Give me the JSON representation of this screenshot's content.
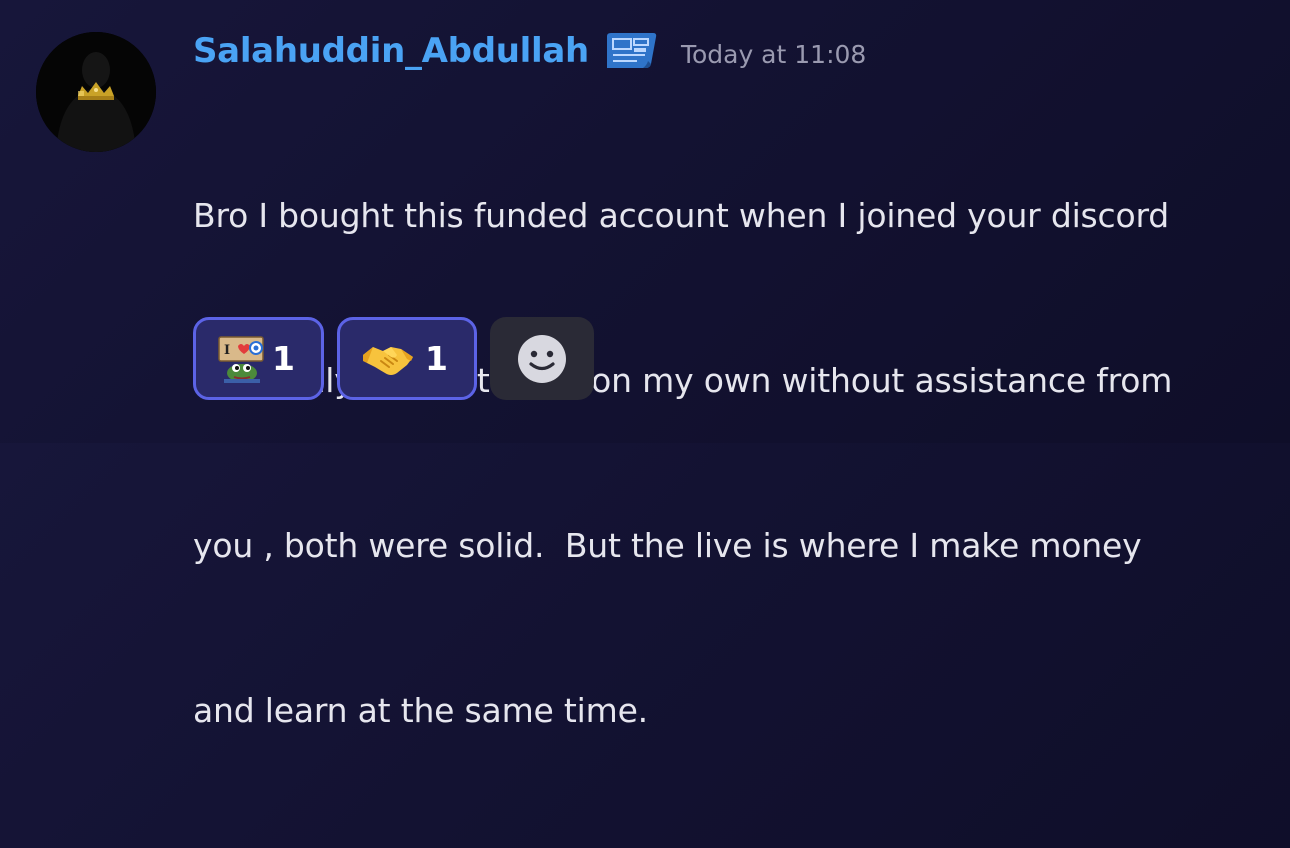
{
  "message": {
    "author": "Salahuddin_Abdullah",
    "role_icon": "blueprint-icon",
    "timestamp": "Today at 11:08",
    "lines": [
      "Bro I bought this funded account when I joined your discord",
      "and I only took 2 trades on my own without assistance from",
      "you , both were solid.  But the live is where I make money",
      "and learn at the same time."
    ]
  },
  "reactions": [
    {
      "emoji": "pepe-i-love-sign-emoji",
      "count": "1"
    },
    {
      "emoji": "handshake-emoji",
      "count": "1"
    }
  ],
  "add_reaction": {
    "icon": "smiley-icon"
  },
  "colors": {
    "username": "#4aa3f4",
    "text": "#e6e6ee",
    "timestamp": "#9a9ab0",
    "reaction_border": "#5c63e6",
    "reaction_bg": "#2a2a6a",
    "background": "#141335"
  }
}
